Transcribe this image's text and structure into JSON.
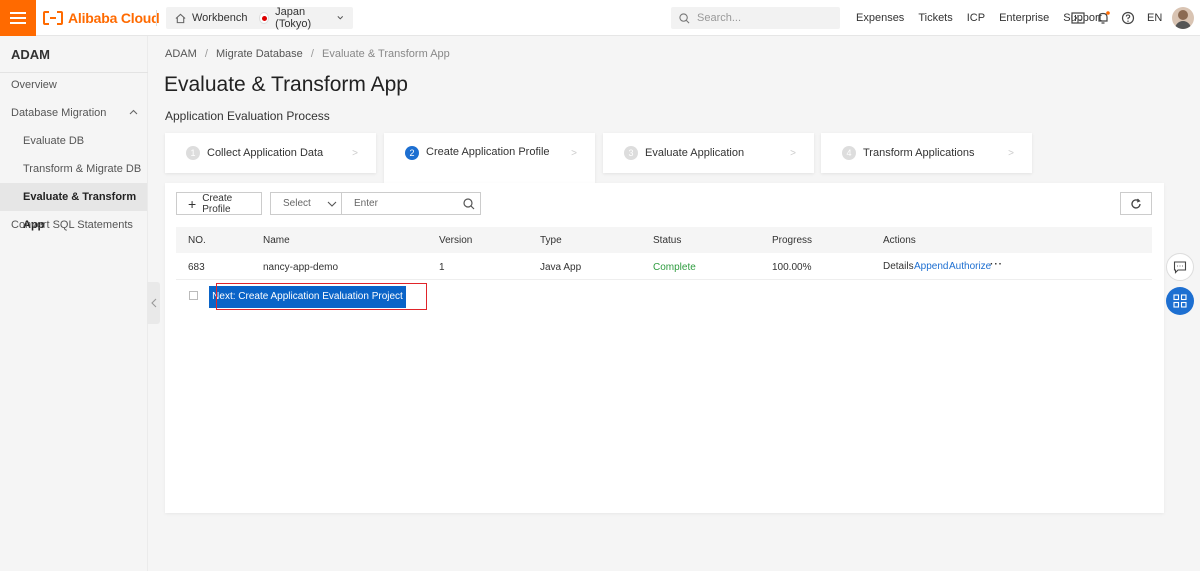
{
  "topbar": {
    "brand": "Alibaba Cloud",
    "workbench": "Workbench",
    "region": "Japan (Tokyo)",
    "search_placeholder": "Search...",
    "links": [
      "Expenses",
      "Tickets",
      "ICP",
      "Enterprise",
      "Support"
    ],
    "lang": "EN",
    "brand_color": "#ff6a00"
  },
  "sidebar": {
    "title": "ADAM",
    "items": [
      {
        "label": "Overview"
      },
      {
        "label": "Database Migration"
      },
      {
        "label": "Evaluate DB"
      },
      {
        "label": "Transform & Migrate DB"
      },
      {
        "label": "Evaluate & Transform App"
      },
      {
        "label": "Convert SQL Statements"
      }
    ]
  },
  "breadcrumb": {
    "items": [
      "ADAM",
      "Migrate Database",
      "Evaluate & Transform App"
    ],
    "separator": "/"
  },
  "page": {
    "title": "Evaluate & Transform App",
    "subtitle": "Application Evaluation Process"
  },
  "steps": [
    {
      "num": "1",
      "label": "Collect Application Data"
    },
    {
      "num": "2",
      "label": "Create Application Profile"
    },
    {
      "num": "3",
      "label": "Evaluate Application"
    },
    {
      "num": "4",
      "label": "Transform Applications"
    }
  ],
  "toolbar": {
    "create_label": "Create Profile",
    "select_label": "Select",
    "enter_placeholder": "Enter"
  },
  "table": {
    "headers": [
      "NO.",
      "Name",
      "Version",
      "Type",
      "Status",
      "Progress",
      "Actions"
    ],
    "rows": [
      {
        "no": "683",
        "name": "nancy-app-demo",
        "version": "1",
        "type": "Java App",
        "status": "Complete",
        "progress": "100.00%",
        "actions": [
          "Details",
          "Append",
          "Authorize",
          "···"
        ]
      }
    ]
  },
  "tooltip": {
    "label": "Next: Create Application Evaluation Project"
  },
  "colors": {
    "accent": "#1d6fd1",
    "success": "#2e9c3f",
    "highlight": "#e0242a"
  }
}
